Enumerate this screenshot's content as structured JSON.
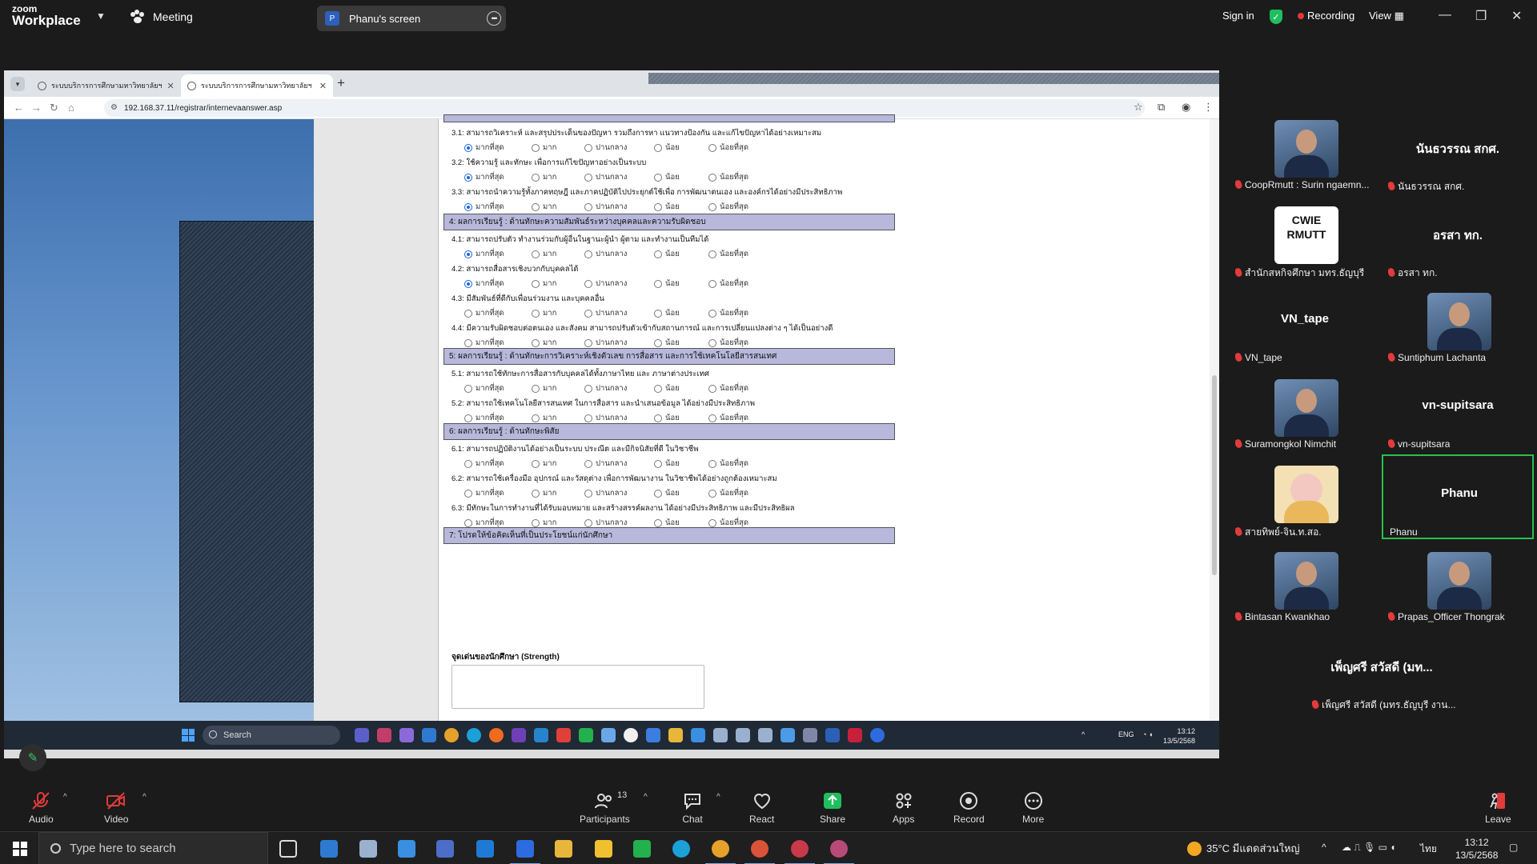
{
  "zoom": {
    "logo_line1": "zoom",
    "logo_line2": "Workplace",
    "meeting_label": "Meeting",
    "share_badge": "P",
    "share_title": "Phanu's screen",
    "sign_in": "Sign in",
    "recording": "Recording",
    "view": "View",
    "colors": {
      "bg": "#1b1b1b",
      "green": "#1fbf5f",
      "record_red": "#e53535",
      "speaking": "#2bbf4c"
    }
  },
  "browser": {
    "tabs": [
      {
        "label": "ระบบบริการการศึกษามหาวิทยาลัยฯ"
      },
      {
        "label": "ระบบบริการการศึกษามหาวิทยาลัยฯ"
      }
    ],
    "url": "192.168.37.11/registrar/internevaanswer.asp"
  },
  "form": {
    "options": [
      "มากที่สุด",
      "มาก",
      "ปานกลาง",
      "น้อย",
      "น้อยที่สุด"
    ],
    "sections": [
      {
        "title": "4: ผลการเรียนรู้ : ด้านทักษะความสัมพันธ์ระหว่างบุคคลและความรับผิดชอบ"
      },
      {
        "title": "5: ผลการเรียนรู้ : ด้านทักษะการวิเคราะห์เชิงตัวเลข การสื่อสาร และการใช้เทคโนโลยีสารสนเทศ"
      },
      {
        "title": "6: ผลการเรียนรู้ : ด้านทักษะพิสัย"
      },
      {
        "title": "7: โปรดให้ข้อคิดเห็นที่เป็นประโยชน์แก่นักศึกษา"
      }
    ],
    "questions": [
      {
        "text": "3.1: สามารถวิเคราะห์ และสรุปประเด็นของปัญหา รวมถึงการหา แนวทางป้องกัน และแก้ไขปัญหาได้อย่างเหมาะสม",
        "selected": 0
      },
      {
        "text": "3.2: ใช้ความรู้ และทักษะ เพื่อการแก้ไขปัญหาอย่างเป็นระบบ",
        "selected": 0
      },
      {
        "text": "3.3: สามารถนำความรู้ทั้งภาคทฤษฎี และภาคปฏิบัติไปประยุกต์ใช้เพื่อ การพัฒนาตนเอง และองค์กรได้อย่างมีประสิทธิภาพ",
        "selected": 0
      },
      {
        "text": "4.1: สามารถปรับตัว ทำงานร่วมกับผู้อื่นในฐานะผู้นำ ผู้ตาม และทำงานเป็นทีมได้",
        "selected": 0
      },
      {
        "text": "4.2: สามารถสื่อสารเชิงบวกกับบุคคลได้",
        "selected": 0
      },
      {
        "text": "4.3: มีสัมพันธ์ที่ดีกับเพื่อนร่วมงาน และบุคคลอื่น",
        "selected": -1
      },
      {
        "text": "4.4: มีความรับผิดชอบต่อตนเอง และสังคม สามารถปรับตัวเข้ากับสถานการณ์ และการเปลี่ยนแปลงต่าง ๆ ได้เป็นอย่างดี",
        "selected": -1
      },
      {
        "text": "5.1: สามารถใช้ทักษะการสื่อสารกับบุคคลได้ทั้งภาษาไทย และ ภาษาต่างประเทศ",
        "selected": -1
      },
      {
        "text": "5.2: สามารถใช้เทคโนโลยีสารสนเทศ ในการสื่อสาร และนำเสนอข้อมูล ได้อย่างมีประสิทธิภาพ",
        "selected": -1
      },
      {
        "text": "6.1: สามารถปฏิบัติงานได้อย่างเป็นระบบ ประณีต และมีกิจนิสัยที่ดี ในวิชาชีพ",
        "selected": -1
      },
      {
        "text": "6.2: สามารถใช้เครื่องมือ อุปกรณ์ และวัสดุต่าง เพื่อการพัฒนางาน ในวิชาชีพได้อย่างถูกต้องเหมาะสม",
        "selected": -1
      },
      {
        "text": "6.3: มีทักษะในการทำงานที่ได้รับมอบหมาย และสร้างสรรค์ผลงาน ได้อย่างมีประสิทธิภาพ และมีประสิทธิผล",
        "selected": -1
      }
    ],
    "strength_label": "จุดเด่นของนักศึกษา (Strength)"
  },
  "inner_taskbar": {
    "search": "Search",
    "lang": "ENG",
    "time": "13:12",
    "date": "13/5/2568"
  },
  "participants": [
    {
      "name": "CoopRmutt : Surin ngaemn...",
      "display": "",
      "photo": true
    },
    {
      "name": "นันธวรรณ สกศ.",
      "display": "นันธวรรณ สกศ.",
      "photo": false
    },
    {
      "name": "สำนักสหกิจศึกษา มทร.ธัญบุรี",
      "display": "",
      "photo": "logo",
      "logo_text": "CWIE RMUTT"
    },
    {
      "name": "อรสา ทก.",
      "display": "อรสา ทก.",
      "photo": false
    },
    {
      "name": "VN_tape",
      "display": "VN_tape",
      "photo": false
    },
    {
      "name": "Suntiphum Lachanta",
      "display": "",
      "photo": true
    },
    {
      "name": "Suramongkol Nimchit",
      "display": "",
      "photo": true
    },
    {
      "name": "vn-supitsara",
      "display": "vn-supitsara",
      "photo": false
    },
    {
      "name": "สายทิพย์-จิน.ท.สอ.",
      "display": "",
      "photo": "pig"
    },
    {
      "name": "Phanu",
      "display": "Phanu",
      "photo": false,
      "speaking": true
    },
    {
      "name": "Bintasan Kwankhao",
      "display": "",
      "photo": true
    },
    {
      "name": "Prapas_Officer Thongrak",
      "display": "",
      "photo": true
    },
    {
      "name": "เพ็ญศรี สวัสดี (มทร.ธัญบุรี งาน...",
      "display": "เพ็ญศรี สวัสดี (มท...",
      "photo": false
    }
  ],
  "toolbar": {
    "audio": "Audio",
    "video": "Video",
    "participants": "Participants",
    "participants_count": "13",
    "chat": "Chat",
    "react": "React",
    "share": "Share",
    "apps": "Apps",
    "record": "Record",
    "more": "More",
    "leave": "Leave"
  },
  "windows_taskbar": {
    "search_placeholder": "Type here to search",
    "weather": "35°C มีแดดส่วนใหญ่",
    "lang": "ไทย",
    "time": "13:12",
    "date": "13/5/2568"
  }
}
